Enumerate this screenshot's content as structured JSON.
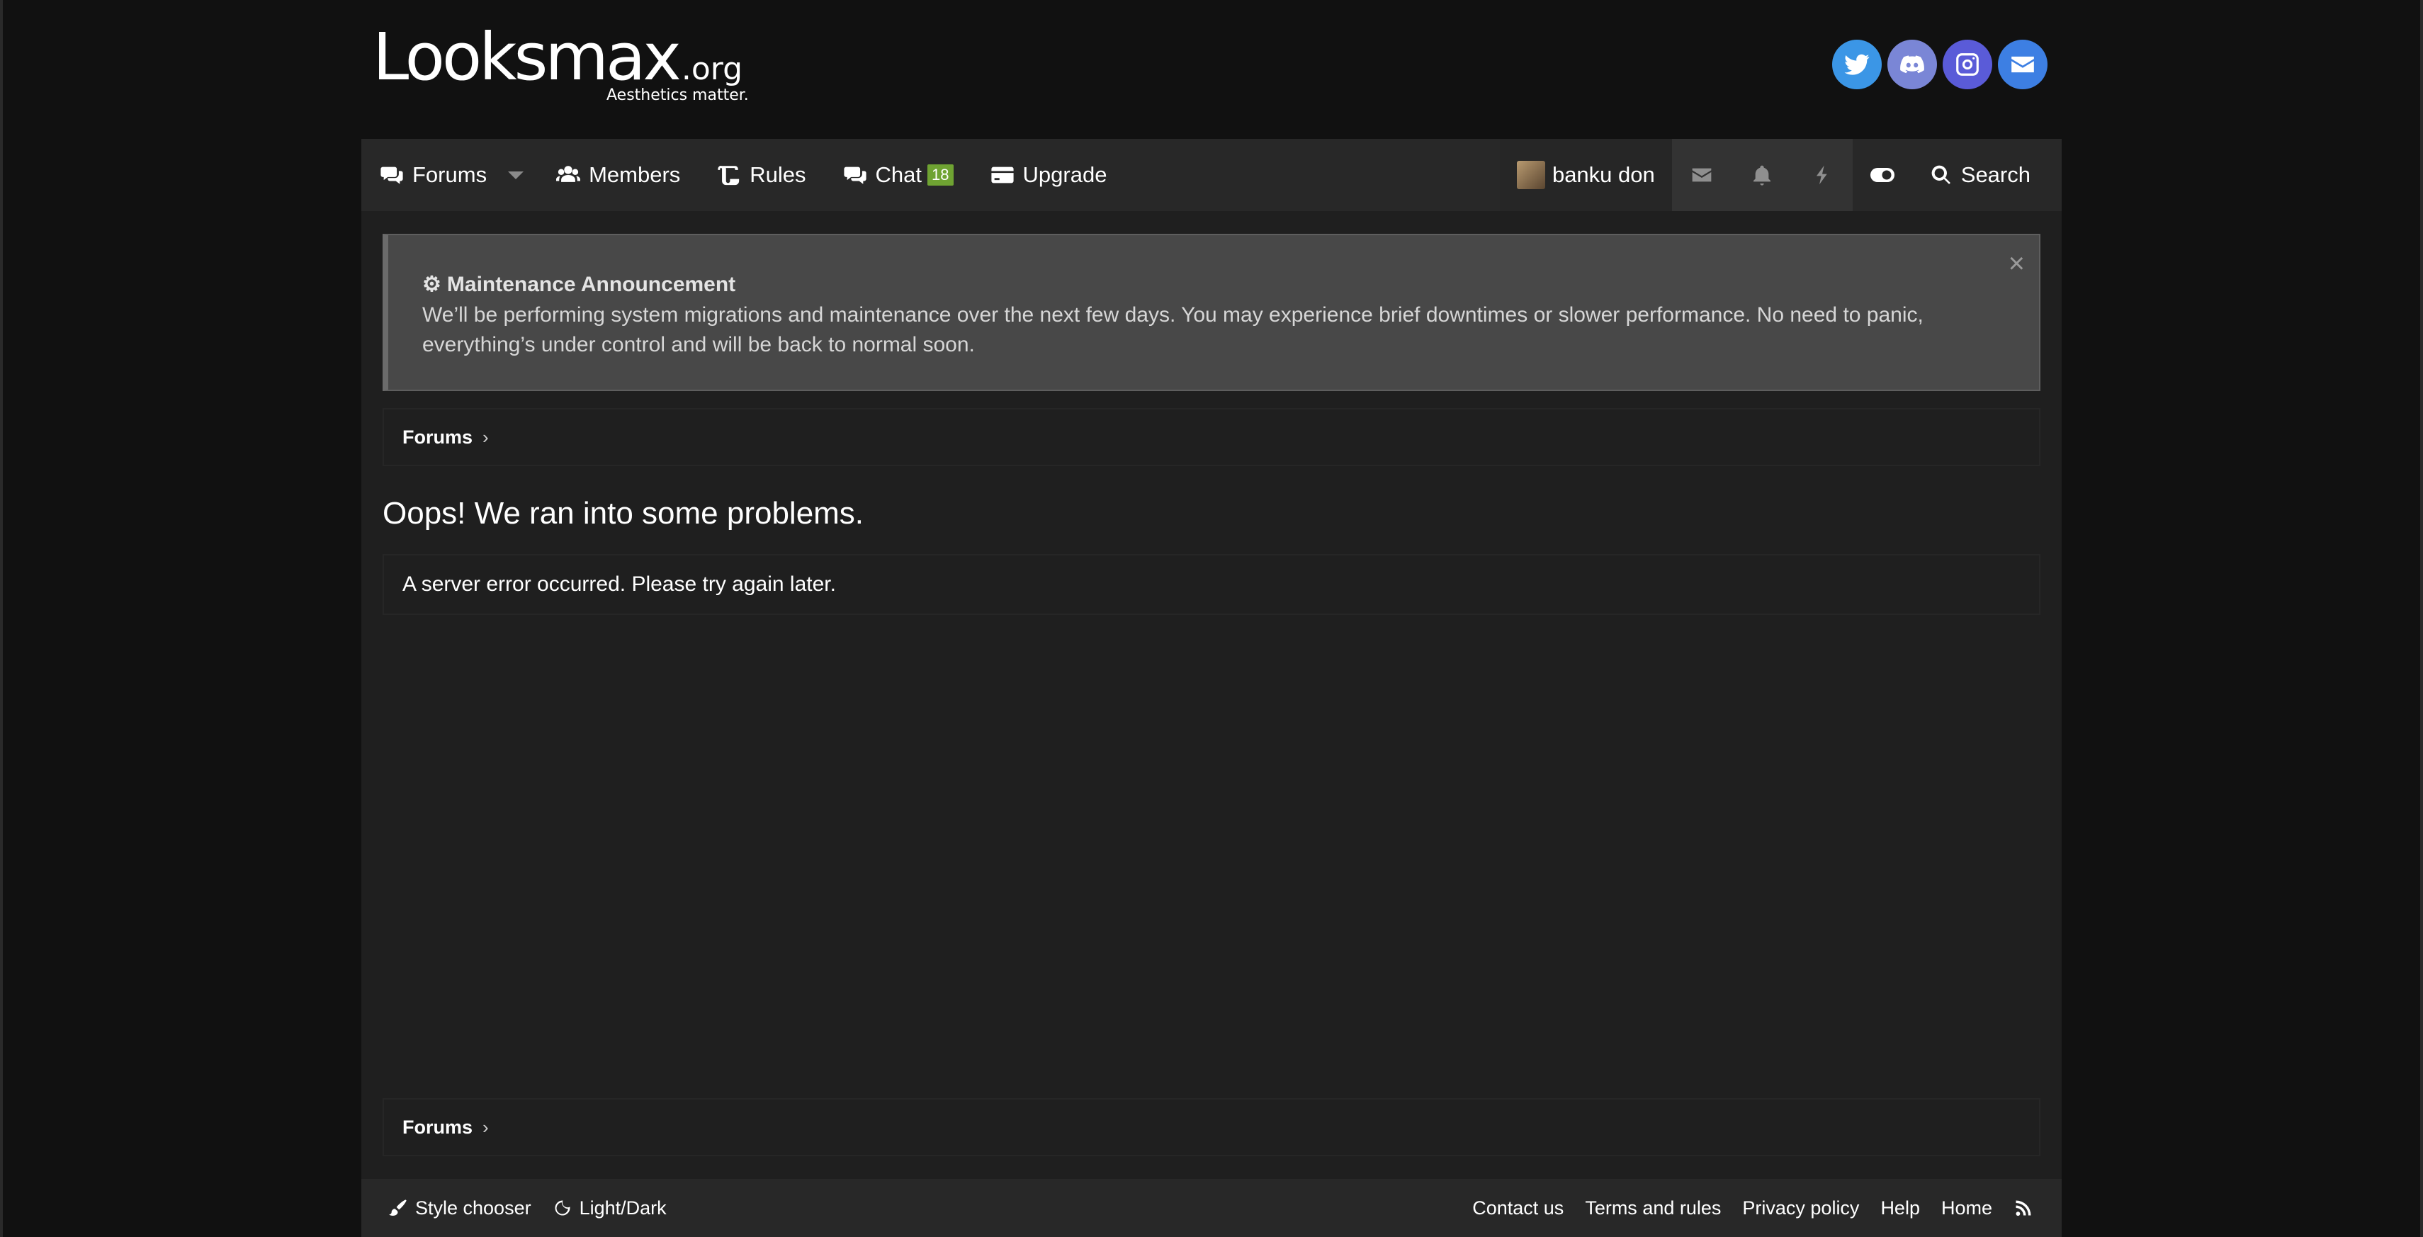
{
  "brand": {
    "logo_main": "Looksmax",
    "logo_org": ".org",
    "tagline": "Aesthetics matter."
  },
  "social": [
    "twitter-icon",
    "discord-icon",
    "instagram-icon",
    "email-icon"
  ],
  "nav": {
    "forums": "Forums",
    "members": "Members",
    "rules": "Rules",
    "chat": "Chat",
    "chat_badge": "18",
    "upgrade": "Upgrade",
    "username": "banku don",
    "search": "Search"
  },
  "notice": {
    "title": "Maintenance Announcement",
    "body": "We’ll be performing system migrations and maintenance over the next few days. You may experience brief downtimes or slower performance. No need to panic, everything’s under control and will be back to normal soon.",
    "close": "×"
  },
  "breadcrumb": {
    "top": "Forums",
    "bottom": "Forums",
    "chevron": "›"
  },
  "error": {
    "title": "Oops! We ran into some problems.",
    "message": "A server error occurred. Please try again later."
  },
  "footer": {
    "style_chooser": "Style chooser",
    "light_dark": "Light/Dark",
    "links": [
      "Contact us",
      "Terms and rules",
      "Privacy policy",
      "Help",
      "Home"
    ]
  },
  "colors": {
    "background": "#111111",
    "nav": "#282828",
    "panel": "#1f1f1f",
    "notice": "#484848",
    "badge": "#6fa332"
  }
}
